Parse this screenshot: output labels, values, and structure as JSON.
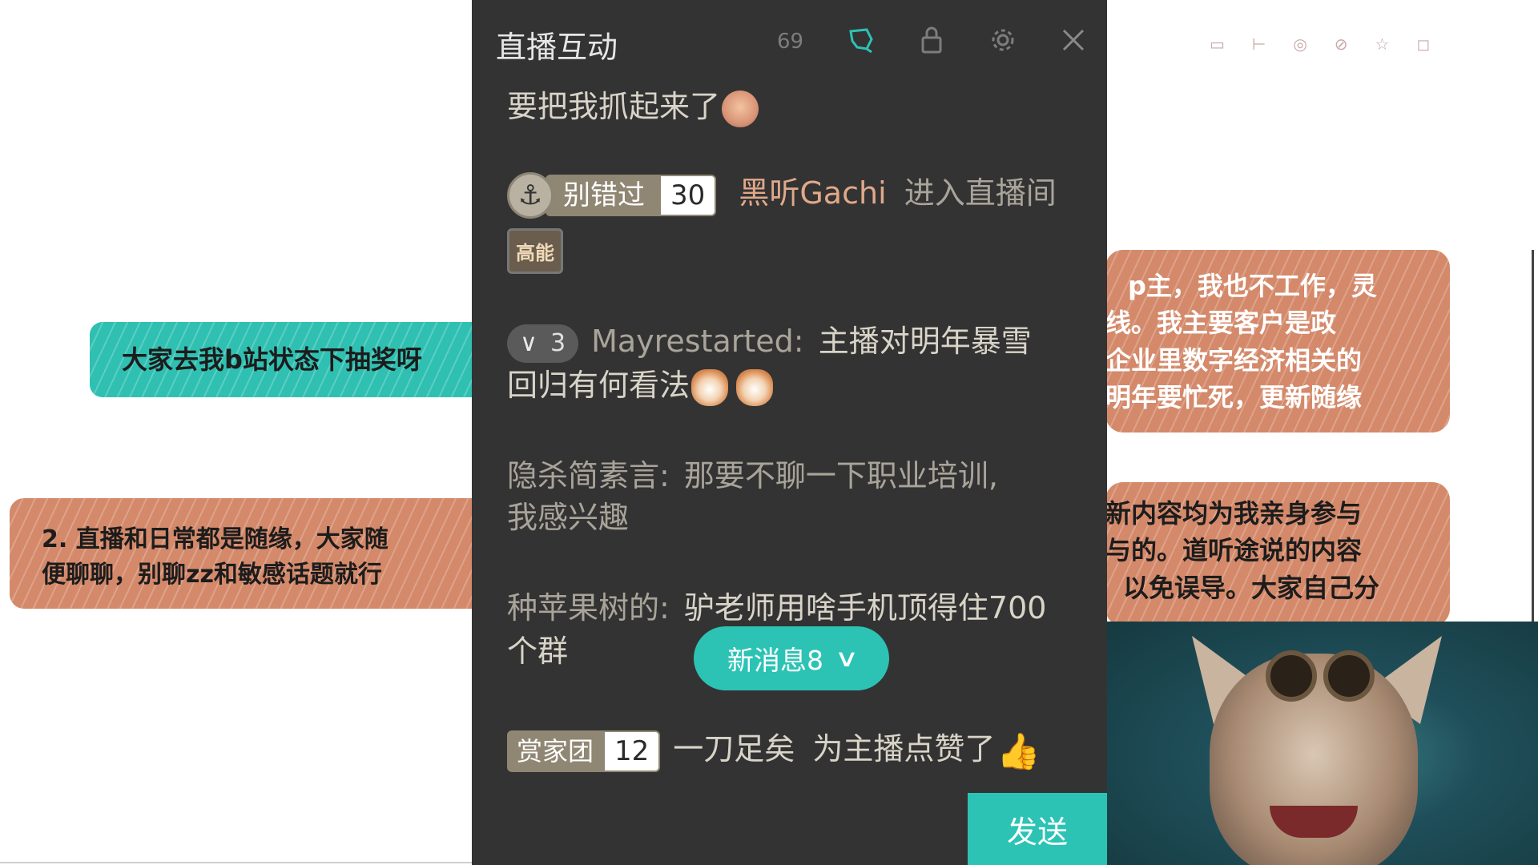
{
  "background": {
    "note_teal": "大家去我b站状态下抽奖呀",
    "note_orange_left": [
      "2. 直播和日常都是随缘，大家随",
      "便聊聊，别聊zz和敏感话题就行"
    ],
    "note_orange_right1": [
      "p主，我也不工作，灵",
      "线。我主要客户是政",
      "企业里数字经济相关的",
      "明年要忙死，更新随缘"
    ],
    "note_orange_right2": [
      "新内容均为我亲身参与",
      "与的。道听途说的内容",
      "以免误导。大家自己分"
    ]
  },
  "panel": {
    "title": "直播互动",
    "icons": [
      "sixtynine-icon",
      "shake-icon",
      "lock-icon",
      "gear-icon",
      "close-icon"
    ]
  },
  "messages": [
    {
      "text": "要把我抓起来了",
      "emoji": "crying-face"
    },
    {
      "anchor_icon": "⚓",
      "medal_name": "别错过",
      "medal_level": "30",
      "user": "黑听Gachi",
      "action": "进入直播间",
      "tag": "高能"
    },
    {
      "guard_level": "3",
      "user": "Mayrestarted:",
      "line1": "主播对明年暴雪",
      "line2": "回归有何看法"
    },
    {
      "user": "隐杀简素言:",
      "line1": "那要不聊一下职业培训,",
      "line2": "我感兴趣"
    },
    {
      "user": "种苹果树的:",
      "line1": "驴老师用啥手机顶得住700",
      "line2": "个群"
    },
    {
      "medal_name": "赏家团",
      "medal_level": "12",
      "user": "一刀足矣",
      "action": "为主播点赞了",
      "emoji": "👍"
    }
  ],
  "new_messages_label": "新消息8",
  "send_label": "发送"
}
